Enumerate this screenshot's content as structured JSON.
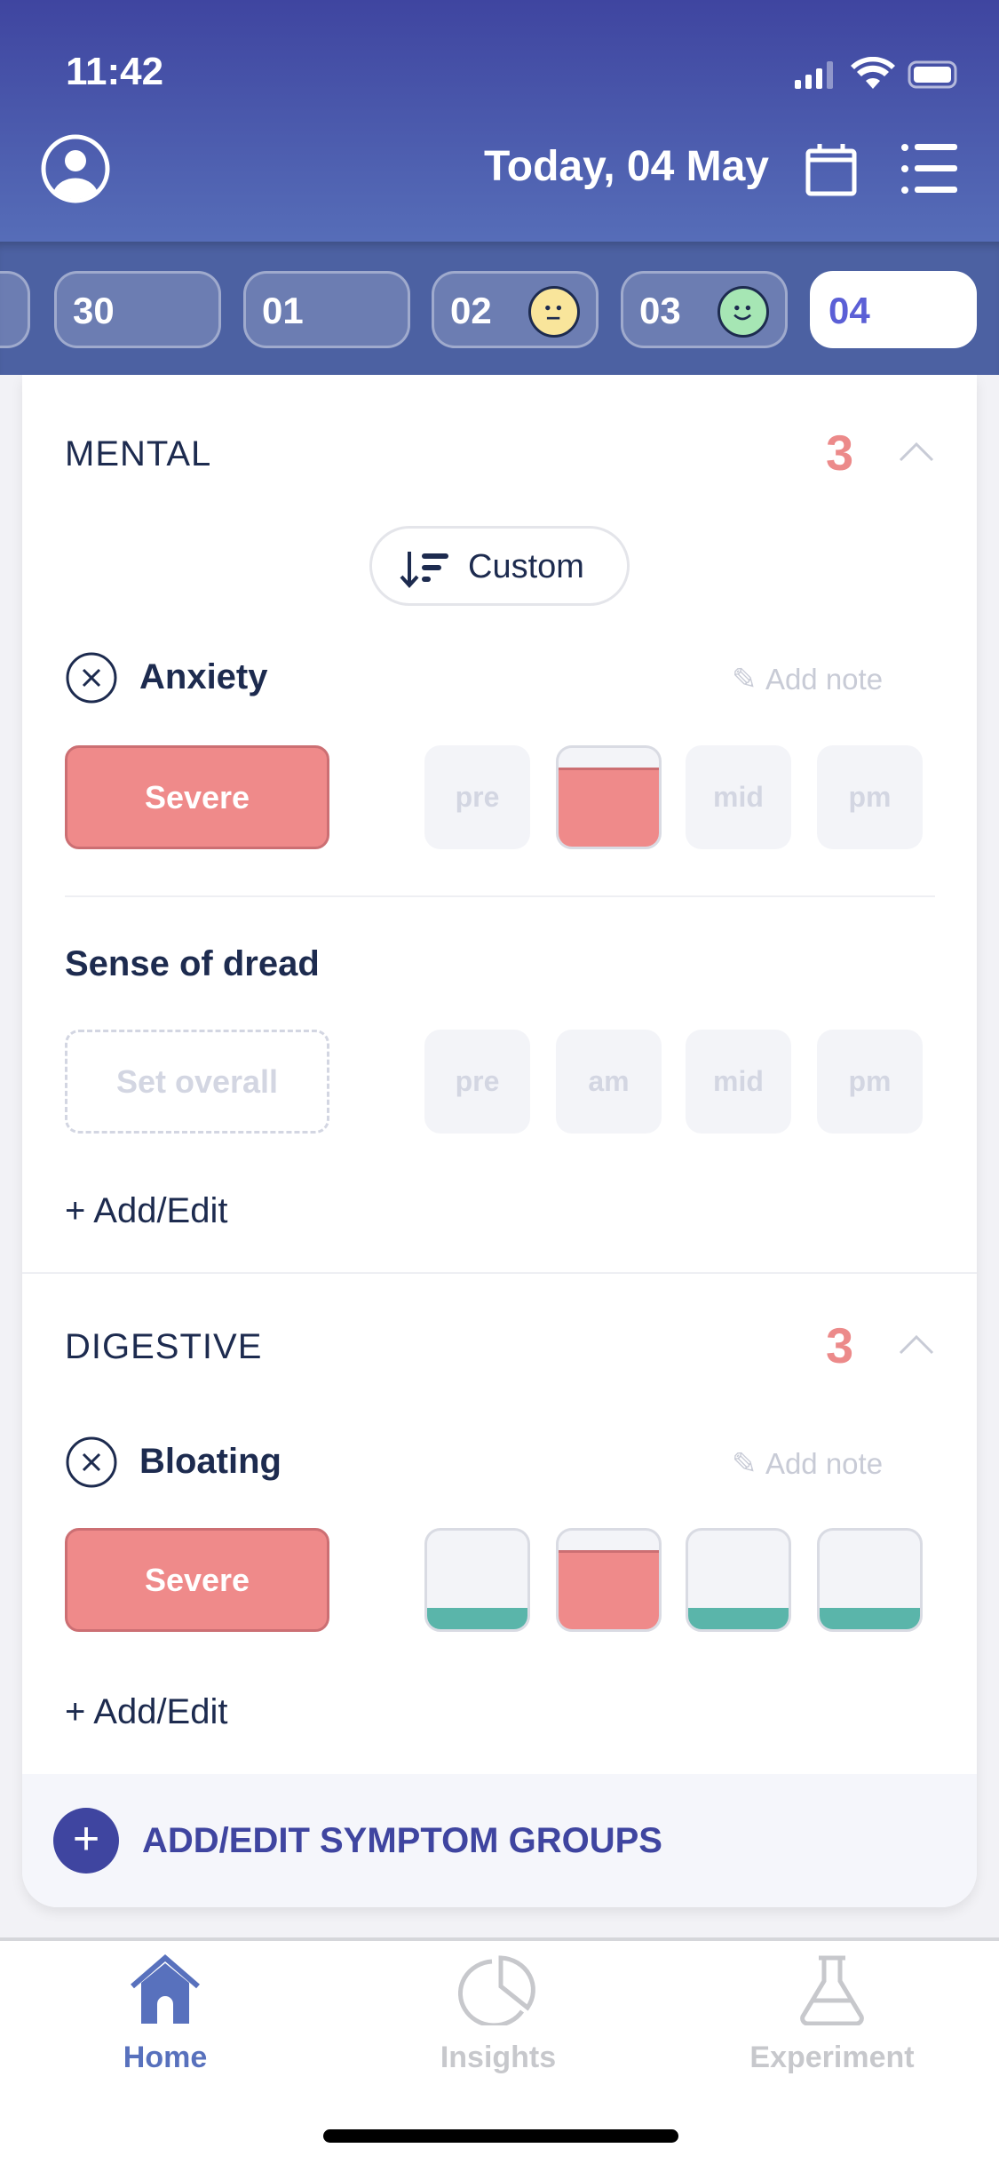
{
  "status": {
    "time": "11:42"
  },
  "header": {
    "title": "Today, 04 May"
  },
  "dates": [
    {
      "label": ""
    },
    {
      "label": "30"
    },
    {
      "label": "01"
    },
    {
      "label": "02",
      "mood": "neutral",
      "mood_color": "#f9e59b"
    },
    {
      "label": "03",
      "mood": "happy",
      "mood_color": "#a6e6b4"
    },
    {
      "label": "04",
      "selected": true
    }
  ],
  "groups": [
    {
      "title": "MENTAL",
      "count": "3",
      "sort_label": "Custom",
      "symptoms": [
        {
          "name": "Anxiety",
          "note": "Add note",
          "overall": "Severe",
          "slots": [
            {
              "label": "pre",
              "level": null
            },
            {
              "label": "",
              "level": "severe"
            },
            {
              "label": "mid",
              "level": null
            },
            {
              "label": "pm",
              "level": null
            }
          ]
        },
        {
          "name": "Sense of dread",
          "overall_placeholder": "Set overall",
          "slots": [
            {
              "label": "pre"
            },
            {
              "label": "am"
            },
            {
              "label": "mid"
            },
            {
              "label": "pm"
            }
          ]
        }
      ],
      "add_label": "+ Add/Edit"
    },
    {
      "title": "DIGESTIVE",
      "count": "3",
      "symptoms": [
        {
          "name": "Bloating",
          "note": "Add note",
          "overall": "Severe",
          "slots": [
            {
              "level": "mild"
            },
            {
              "level": "severe"
            },
            {
              "level": "mild"
            },
            {
              "level": "mild"
            }
          ]
        }
      ],
      "add_label": "+ Add/Edit"
    }
  ],
  "footer": {
    "add_groups_label": "ADD/EDIT SYMPTOM GROUPS"
  },
  "tabs": [
    {
      "label": "Home",
      "active": true
    },
    {
      "label": "Insights"
    },
    {
      "label": "Experiment"
    }
  ],
  "colors": {
    "accent": "#3f45a0",
    "severe": "#ef8a8a",
    "mild": "#5ab5aa",
    "count": "#ec8a8a"
  }
}
